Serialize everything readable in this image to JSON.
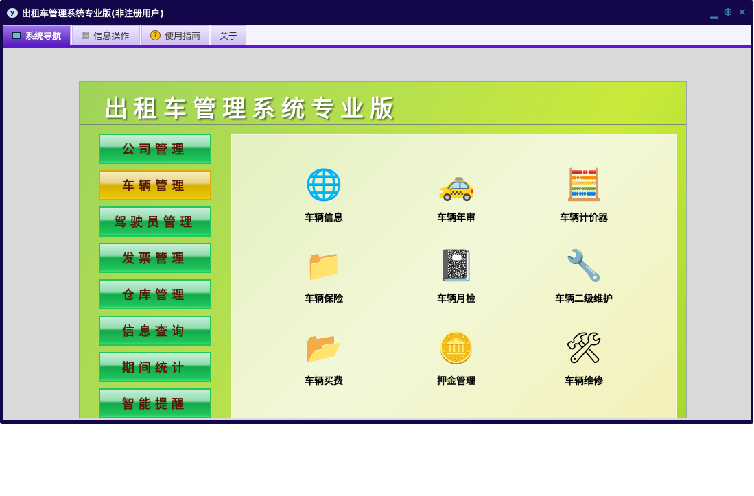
{
  "window": {
    "title": "出租车管理系统专业版(非注册用户)",
    "controls": [
      "minimize",
      "restore",
      "close"
    ]
  },
  "tabs": [
    {
      "label": "系统导航",
      "icon": "monitor-icon",
      "active": true
    },
    {
      "label": "信息操作",
      "icon": "grid-icon"
    },
    {
      "label": "使用指南",
      "icon": "help-icon"
    },
    {
      "label": "关于"
    }
  ],
  "banner": {
    "title": "出租车管理系统专业版"
  },
  "nav": [
    {
      "label": "公司管理"
    },
    {
      "label": "车辆管理",
      "selected": true
    },
    {
      "label": "驾驶员管理"
    },
    {
      "label": "发票管理"
    },
    {
      "label": "仓库管理"
    },
    {
      "label": "信息查询"
    },
    {
      "label": "期间统计"
    },
    {
      "label": "智能提醒"
    }
  ],
  "items": [
    {
      "label": "车辆信息",
      "icon": "globe-car-icon"
    },
    {
      "label": "车辆年审",
      "icon": "taxi-icon"
    },
    {
      "label": "车辆计价器",
      "icon": "calculator-icon"
    },
    {
      "label": "车辆保险",
      "icon": "folder-globe-icon"
    },
    {
      "label": "车辆月检",
      "icon": "notebook-icon"
    },
    {
      "label": "车辆二级维护",
      "icon": "wrench-doc-icon"
    },
    {
      "label": "车辆买费",
      "icon": "folder-coins-icon"
    },
    {
      "label": "押金管理",
      "icon": "coins-icon"
    },
    {
      "label": "车辆维修",
      "icon": "tools-icon"
    }
  ]
}
